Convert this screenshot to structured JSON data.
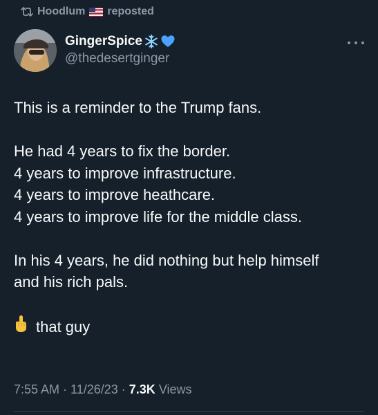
{
  "repost": {
    "user": "Hoodlum",
    "flag_icon": "us-flag-icon",
    "label": "reposted"
  },
  "author": {
    "display_name": "GingerSpice",
    "emojis": [
      "snowflake-icon",
      "blue-heart-icon"
    ],
    "handle": "@thedesertginger"
  },
  "tweet": {
    "lines": [
      "This is a reminder to the Trump fans.",
      "He had 4 years to fix the border.",
      "4 years to improve infrastructure.",
      "4 years to improve  heathcare.",
      "4 years to improve life for the middle class.",
      "In his 4 years, he did nothing but help himself",
      "and his rich pals.",
      "that guy"
    ],
    "last_line_emoji": "middle-finger-icon"
  },
  "meta": {
    "time": "7:55 AM",
    "separator": "·",
    "date": "11/26/23",
    "views_count": "7.3K",
    "views_label": "Views"
  },
  "colors": {
    "background": "#15202b",
    "text": "#f7f9f9",
    "secondary": "#8b98a5",
    "divider": "#38444d"
  }
}
